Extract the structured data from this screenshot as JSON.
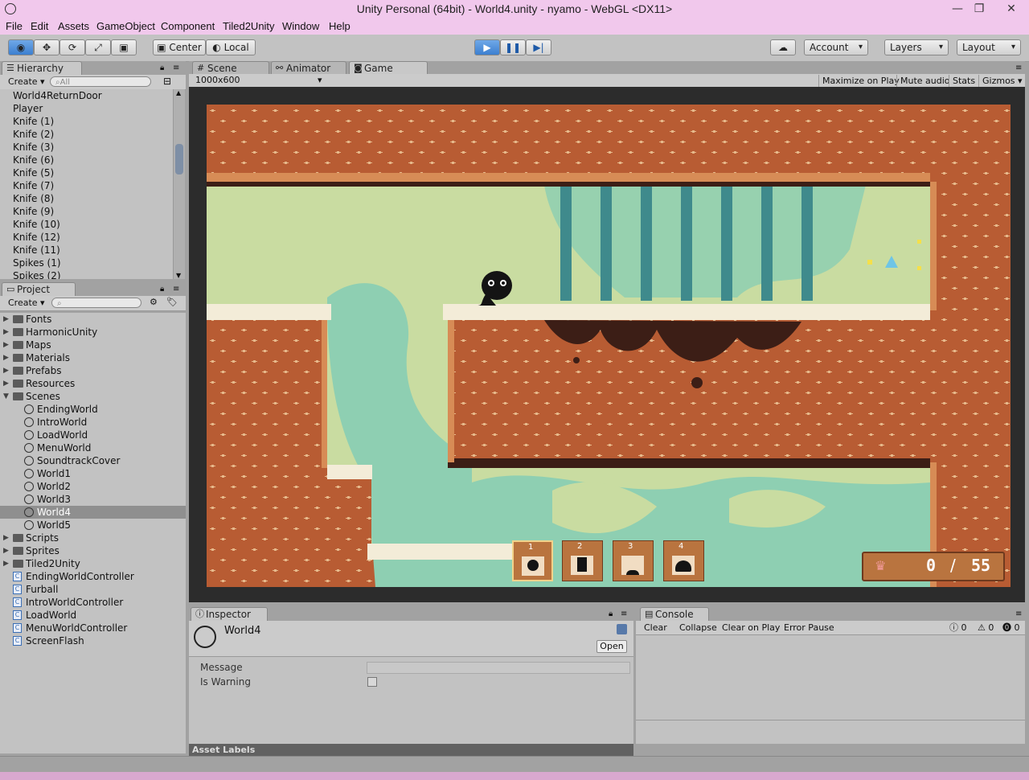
{
  "window": {
    "title": "Unity Personal (64bit) - World4.unity - nyamo - WebGL <DX11>",
    "minimize": "—",
    "maximize": "❐",
    "close": "✕"
  },
  "menu": [
    "File",
    "Edit",
    "Assets",
    "GameObject",
    "Component",
    "Tiled2Unity",
    "Window",
    "Help"
  ],
  "toolbar": {
    "pivot": "Center",
    "space": "Local",
    "account": "Account",
    "layers": "Layers",
    "layout": "Layout"
  },
  "hierarchy": {
    "tab": "Hierarchy",
    "create": "Create",
    "search_placeholder": "All",
    "items": [
      "World4ReturnDoor",
      "Player",
      "Knife (1)",
      "Knife (2)",
      "Knife (3)",
      "Knife (6)",
      "Knife (5)",
      "Knife (7)",
      "Knife (8)",
      "Knife (9)",
      "Knife (10)",
      "Knife (12)",
      "Knife (11)",
      "Spikes (1)",
      "Spikes (2)"
    ]
  },
  "project": {
    "tab": "Project",
    "create": "Create",
    "items": [
      {
        "label": "Fonts",
        "kind": "folder",
        "indent": 0,
        "fold": "closed"
      },
      {
        "label": "HarmonicUnity",
        "kind": "folder",
        "indent": 0,
        "fold": "closed"
      },
      {
        "label": "Maps",
        "kind": "folder",
        "indent": 0,
        "fold": "closed"
      },
      {
        "label": "Materials",
        "kind": "folder",
        "indent": 0,
        "fold": "closed"
      },
      {
        "label": "Prefabs",
        "kind": "folder",
        "indent": 0,
        "fold": "closed"
      },
      {
        "label": "Resources",
        "kind": "folder",
        "indent": 0,
        "fold": "closed"
      },
      {
        "label": "Scenes",
        "kind": "folder",
        "indent": 0,
        "fold": "open"
      },
      {
        "label": "EndingWorld",
        "kind": "scene",
        "indent": 1
      },
      {
        "label": "IntroWorld",
        "kind": "scene",
        "indent": 1
      },
      {
        "label": "LoadWorld",
        "kind": "scene",
        "indent": 1
      },
      {
        "label": "MenuWorld",
        "kind": "scene",
        "indent": 1
      },
      {
        "label": "SoundtrackCover",
        "kind": "scene",
        "indent": 1
      },
      {
        "label": "World1",
        "kind": "scene",
        "indent": 1
      },
      {
        "label": "World2",
        "kind": "scene",
        "indent": 1
      },
      {
        "label": "World3",
        "kind": "scene",
        "indent": 1
      },
      {
        "label": "World4",
        "kind": "scene",
        "indent": 1,
        "selected": true
      },
      {
        "label": "World5",
        "kind": "scene",
        "indent": 1
      },
      {
        "label": "Scripts",
        "kind": "folder",
        "indent": 0,
        "fold": "closed"
      },
      {
        "label": "Sprites",
        "kind": "folder",
        "indent": 0,
        "fold": "closed"
      },
      {
        "label": "Tiled2Unity",
        "kind": "folder",
        "indent": 0,
        "fold": "closed"
      },
      {
        "label": "EndingWorldController",
        "kind": "script",
        "indent": 0
      },
      {
        "label": "Furball",
        "kind": "script",
        "indent": 0
      },
      {
        "label": "IntroWorldController",
        "kind": "script",
        "indent": 0
      },
      {
        "label": "LoadWorld",
        "kind": "script",
        "indent": 0
      },
      {
        "label": "MenuWorldController",
        "kind": "script",
        "indent": 0
      },
      {
        "label": "ScreenFlash",
        "kind": "script",
        "indent": 0
      }
    ]
  },
  "tabs": {
    "scene": "Scene",
    "animator": "Animator",
    "game": "Game"
  },
  "game_toolbar": {
    "resolution": "1000x600",
    "maximize": "Maximize on Play",
    "mute": "Mute audio",
    "stats": "Stats",
    "gizmos": "Gizmos"
  },
  "hud": {
    "slots": [
      "1",
      "2",
      "3",
      "4"
    ],
    "deaths": "0",
    "total": "55"
  },
  "inspector": {
    "tab": "Inspector",
    "object_name": "World4",
    "open_button": "Open",
    "message_label": "Message",
    "warning_label": "Is Warning",
    "asset_labels": "Asset Labels"
  },
  "console": {
    "tab": "Console",
    "clear": "Clear",
    "collapse": "Collapse",
    "clear_on_play": "Clear on Play",
    "error_pause": "Error Pause",
    "count_info": "0",
    "count_warn": "0",
    "count_error": "0"
  },
  "colors": {
    "accent_blue": "#3c7fd0",
    "brick": "#b85c33",
    "sky": "#c9dca1",
    "teal": "#8ecfb2"
  }
}
